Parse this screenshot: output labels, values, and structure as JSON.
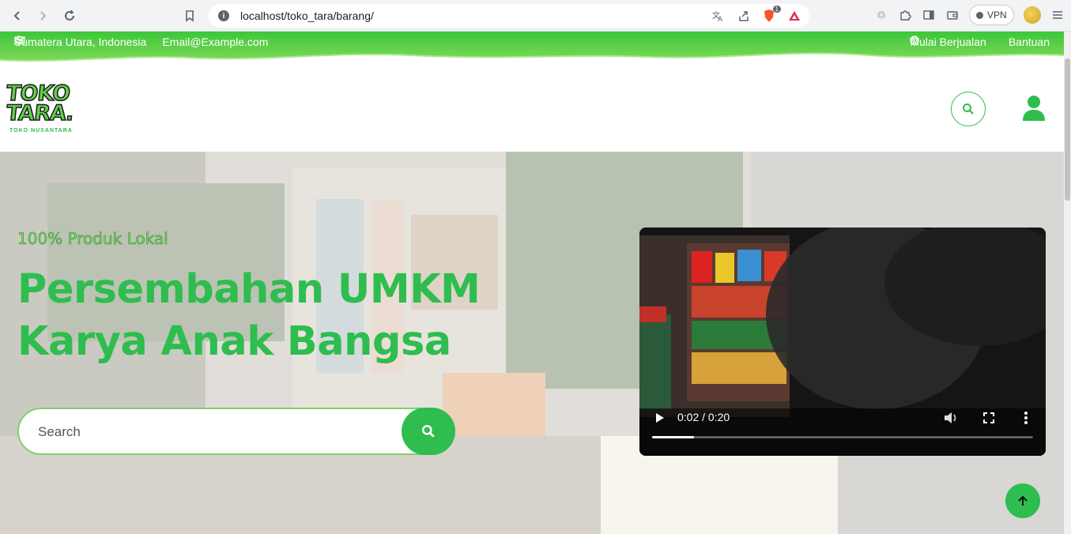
{
  "browser": {
    "url": "localhost/toko_tara/barang/",
    "vpn_label": "VPN",
    "brave_badge": "1"
  },
  "topbar": {
    "location": "Sumatera Utara, Indonesia",
    "email": "Email@Example.com",
    "sell": "Mulai Berjualan",
    "help": "Bantuan"
  },
  "logo": {
    "line1": "TOKO",
    "line2": "TARA.",
    "sub": "TOKO NUSANTARA"
  },
  "hero": {
    "tagline": "100% Produk Lokal",
    "headline": "Persembahan UMKM Karya Anak Bangsa",
    "search_placeholder": "Search"
  },
  "video": {
    "time": "0:02 / 0:20",
    "progress": 0.11
  },
  "colors": {
    "brand_green": "#2ebd4e",
    "light_green": "#7bd66a"
  },
  "icons": {
    "topbar": [
      "map-pin-icon",
      "envelope-icon",
      "shop-icon",
      "info-icon"
    ],
    "header": [
      "search-icon",
      "user-icon"
    ],
    "scroll": "arrow-up-icon"
  }
}
